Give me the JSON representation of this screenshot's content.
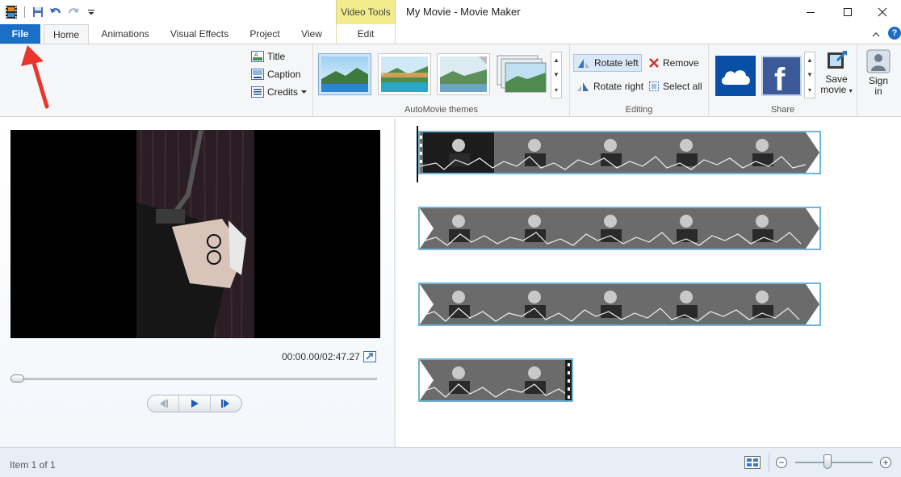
{
  "window": {
    "title": "My Movie - Movie Maker",
    "contextual_tab": "Video Tools"
  },
  "tabs": [
    {
      "label": "File"
    },
    {
      "label": "Home"
    },
    {
      "label": "Animations"
    },
    {
      "label": "Visual Effects"
    },
    {
      "label": "Project"
    },
    {
      "label": "View"
    },
    {
      "label": "Edit"
    }
  ],
  "ribbon": {
    "text_group": {
      "title": "Title",
      "caption": "Caption",
      "credits": "Credits"
    },
    "themes_group": {
      "label": "AutoMovie themes"
    },
    "editing_group": {
      "label": "Editing",
      "rotate_left": "Rotate left",
      "rotate_right": "Rotate right",
      "remove": "Remove",
      "select_all": "Select all"
    },
    "share_group": {
      "label": "Share",
      "save_movie_line1": "Save",
      "save_movie_line2": "movie"
    },
    "sign_in_line1": "Sign",
    "sign_in_line2": "in"
  },
  "preview": {
    "timecode": "00:00.00/02:47.27",
    "seek_progress": 0
  },
  "storyboard": {
    "clips": [
      {
        "frames": 5,
        "selected": false
      },
      {
        "frames": 5,
        "selected": false
      },
      {
        "frames": 5,
        "selected": false
      },
      {
        "frames": 2,
        "selected": false
      }
    ]
  },
  "status": {
    "item_text": "Item 1 of 1"
  },
  "colors": {
    "file_tab": "#1c6fc7",
    "contextual_tab": "#f3ec8c",
    "clip_border": "#6fb4d9",
    "annotation_arrow": "#e8362d"
  }
}
